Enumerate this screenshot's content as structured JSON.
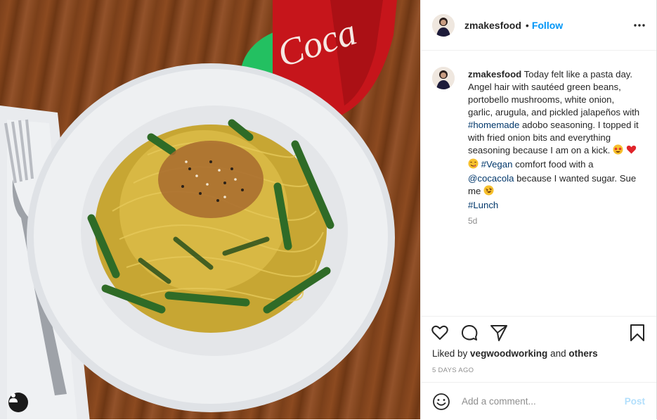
{
  "post": {
    "username": "zmakesfood",
    "follow_label": "Follow",
    "dot": "•",
    "caption": {
      "username": "zmakesfood",
      "text_1": " Today felt like a pasta day. Angel hair with sautéed green beans, portobello mushrooms, white onion, garlic, arugula, and pickled jalapeños with ",
      "tag_homemade": "#homemade",
      "text_2": " adobo seasoning. I topped it with fried onion bits and everything seasoning because I am on a kick. ",
      "tag_vegan": "#Vegan",
      "text_3": " comfort food with a ",
      "mention": "@cocacola",
      "text_4": " because I wanted sugar. Sue me ",
      "tag_lunch": "#Lunch"
    },
    "age": "5d",
    "likes": {
      "prefix": "Liked by ",
      "user": "vegwoodworking",
      "middle": " and ",
      "others": "others"
    },
    "date": "5 DAYS AGO"
  },
  "comment": {
    "placeholder": "Add a comment...",
    "post_label": "Post"
  },
  "icons": {
    "more": "more-horizontal-icon",
    "like": "heart-outline-icon",
    "comment": "comment-bubble-icon",
    "share": "paper-plane-icon",
    "save": "bookmark-icon",
    "emoji": "smiley-icon",
    "user_tags": "person-icon"
  },
  "colors": {
    "accent": "#0095f6",
    "link": "#00376b",
    "muted": "#8e8e8e",
    "post_disabled": "#b2dffc"
  }
}
